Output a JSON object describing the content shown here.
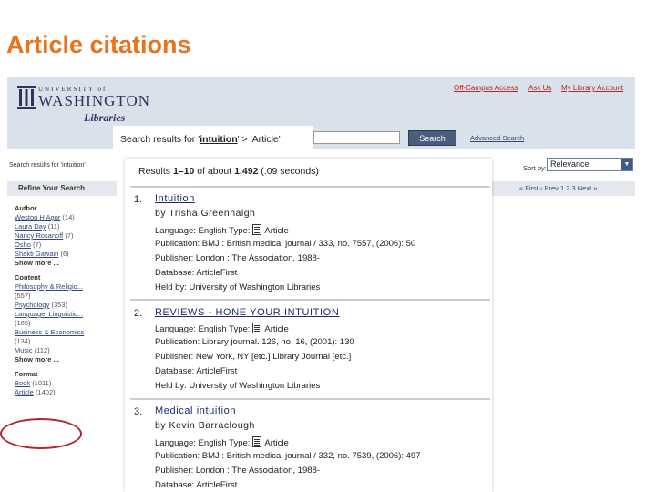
{
  "slide_title": "Article citations",
  "header": {
    "logo_university": "UNIVERSITY of",
    "logo_washington": "WASHINGTON",
    "logo_libraries": "Libraries",
    "links": [
      "Off-Campus Access",
      "Ask Us",
      "My Library Account"
    ]
  },
  "search": {
    "button": "Search",
    "advanced": "Advanced Search",
    "label_prefix": "Search results for '",
    "term": "intuition",
    "label_suffix": "' > 'Article'"
  },
  "background": {
    "results_for": "Search results for 'intuition'",
    "sort_label": "Sort by:",
    "sort_value": "Relevance",
    "refine_title": "Refine Your Search",
    "pager": "« First ‹ Prev 1 2 3 Next »"
  },
  "facets": [
    {
      "title": "Author",
      "items": [
        {
          "label": "Weston H Agor",
          "count": "(14)"
        },
        {
          "label": "Laura Day",
          "count": "(11)"
        },
        {
          "label": "Nancy Rosanoff",
          "count": "(7)"
        },
        {
          "label": "Osho",
          "count": "(7)"
        },
        {
          "label": "Shakti Gawain",
          "count": "(6)"
        }
      ],
      "more": "Show more ..."
    },
    {
      "title": "Content",
      "items": [
        {
          "label": "Philosophy & Religio...",
          "count": ""
        },
        {
          "label": "",
          "count": "(557)"
        },
        {
          "label": "Psychology",
          "count": "(353)"
        },
        {
          "label": "Language, Linguistic...",
          "count": ""
        },
        {
          "label": "",
          "count": "(165)"
        },
        {
          "label": "Business & Economics",
          "count": ""
        },
        {
          "label": "",
          "count": "(134)"
        },
        {
          "label": "Music",
          "count": "(112)"
        }
      ],
      "more": "Show more ..."
    },
    {
      "title": "Format",
      "items": [
        {
          "label": "Book",
          "count": "(1011)"
        },
        {
          "label": "Article",
          "count": "(1402)"
        }
      ],
      "more": ""
    }
  ],
  "results": {
    "summary_prefix": "Results ",
    "summary_range": "1–10",
    "summary_mid": " of about ",
    "summary_total": "1,492",
    "summary_time": " (.09 seconds)",
    "items": [
      {
        "num": "1.",
        "title": "Intuition",
        "author": "by Trisha Greenhalgh",
        "language": "Language: English  Type:",
        "type": "Article",
        "publication": "Publication: BMJ : British medical journal / 333, no. 7557, (2006): 50",
        "publisher": "Publisher: London : The Association, 1988-",
        "database": "Database: ArticleFirst",
        "held": "Held by: University of Washington Libraries"
      },
      {
        "num": "2.",
        "title": "REVIEWS - HONE YOUR INTUITION",
        "author": "",
        "language": "Language: English  Type:",
        "type": "Article",
        "publication": "Publication: Library journal. 126, no. 16, (2001): 130",
        "publisher": "Publisher: New York, NY [etc.] Library Journal [etc.]",
        "database": "Database: ArticleFirst",
        "held": "Held by: University of Washington Libraries"
      },
      {
        "num": "3.",
        "title": "Medical intuition",
        "author": "by Kevin Barraclough",
        "language": "Language: English  Type:",
        "type": "Article",
        "publication": "Publication: BMJ : British medical journal / 332, no. 7539, (2006): 497",
        "publisher": "Publisher: London : The Association, 1988-",
        "database": "Database: ArticleFirst",
        "held": ""
      }
    ]
  }
}
